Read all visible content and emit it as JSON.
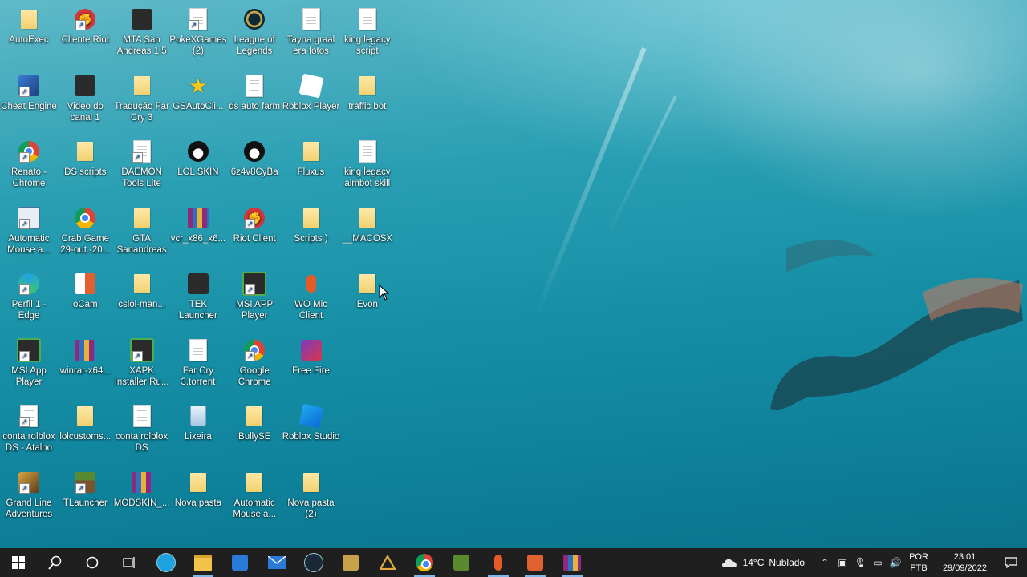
{
  "desktop": {
    "icons": [
      {
        "label": "AutoExec",
        "type": "folder"
      },
      {
        "label": "Cliente Riot",
        "type": "riot"
      },
      {
        "label": "MTA San Andreas 1.5",
        "type": "dark"
      },
      {
        "label": "PokeXGames (2)",
        "type": "file"
      },
      {
        "label": "League of Legends",
        "type": "lol"
      },
      {
        "label": "Tayna graal era fotos",
        "type": "file"
      },
      {
        "label": "king legacy script",
        "type": "file"
      },
      {
        "label": "Cheat Engine",
        "type": "cheat"
      },
      {
        "label": "Video do canal 1",
        "type": "dark"
      },
      {
        "label": "Tradução Far Cry 3",
        "type": "folder"
      },
      {
        "label": "GSAutoCli...",
        "type": "star"
      },
      {
        "label": "ds auto farm",
        "type": "file"
      },
      {
        "label": "Roblox Player",
        "type": "roblox"
      },
      {
        "label": "traffic bot",
        "type": "folder"
      },
      {
        "label": "Renato - Chrome",
        "type": "chrome"
      },
      {
        "label": "DS scripts",
        "type": "folder"
      },
      {
        "label": "DAEMON Tools Lite",
        "type": "file"
      },
      {
        "label": "LOL SKIN",
        "type": "penguin"
      },
      {
        "label": "6z4v8CyBa",
        "type": "penguin"
      },
      {
        "label": "Fluxus",
        "type": "folder"
      },
      {
        "label": "king legacy aimbot skill",
        "type": "file"
      },
      {
        "label": "Automatic Mouse a...",
        "type": "mouse"
      },
      {
        "label": "Crab Game 29-out.-20...",
        "type": "chrome"
      },
      {
        "label": "GTA Sanandreas",
        "type": "folder"
      },
      {
        "label": "vcr_x86_x6...",
        "type": "winrar"
      },
      {
        "label": "Riot Client",
        "type": "riot"
      },
      {
        "label": "Scripts )",
        "type": "folder"
      },
      {
        "label": "__MACOSX",
        "type": "folder"
      },
      {
        "label": "Perfil 1 - Edge",
        "type": "edge"
      },
      {
        "label": "oCam",
        "type": "ocam"
      },
      {
        "label": "cslol-man...",
        "type": "folder"
      },
      {
        "label": "TEK Launcher",
        "type": "dark"
      },
      {
        "label": "MSI APP Player",
        "type": "msi"
      },
      {
        "label": "WO Mic Client",
        "type": "mic"
      },
      {
        "label": "Evon",
        "type": "folder"
      },
      {
        "label": "MSI App Player",
        "type": "msi"
      },
      {
        "label": "winrar-x64...",
        "type": "winrar"
      },
      {
        "label": "XAPK Installer Ru...",
        "type": "msi"
      },
      {
        "label": "Far Cry 3.torrent",
        "type": "file"
      },
      {
        "label": "Google Chrome",
        "type": "chrome"
      },
      {
        "label": "Free Fire",
        "type": "freefire"
      },
      {
        "label": "",
        "type": "none"
      },
      {
        "label": "conta rolblox DS - Atalho",
        "type": "file"
      },
      {
        "label": "lolcustoms...",
        "type": "folder"
      },
      {
        "label": "conta rolblox DS",
        "type": "file"
      },
      {
        "label": "Lixeira",
        "type": "trash"
      },
      {
        "label": "BullySE",
        "type": "folder"
      },
      {
        "label": "Roblox Studio",
        "type": "studio"
      },
      {
        "label": "",
        "type": "none"
      },
      {
        "label": "Grand Line Adventures",
        "type": "grand"
      },
      {
        "label": "TLauncher",
        "type": "tlauncher"
      },
      {
        "label": "MODSKIN_...",
        "type": "winrar"
      },
      {
        "label": "Nova pasta",
        "type": "folder"
      },
      {
        "label": "Automatic Mouse a...",
        "type": "folder"
      },
      {
        "label": "Nova pasta (2)",
        "type": "folder"
      },
      {
        "label": "",
        "type": "none"
      }
    ]
  },
  "taskbar": {
    "apps": [
      {
        "name": "start-button",
        "color": "#ffffff",
        "glyph": "win"
      },
      {
        "name": "search-button",
        "color": "#ffffff",
        "glyph": "search"
      },
      {
        "name": "cortana-button",
        "color": "#ffffff",
        "glyph": "circle"
      },
      {
        "name": "task-view-button",
        "color": "#ffffff",
        "glyph": "taskview"
      },
      {
        "name": "edge-taskbar",
        "color": "#1fa3e0",
        "glyph": "round"
      },
      {
        "name": "file-explorer-taskbar",
        "color": "#f3c24a",
        "glyph": "folder",
        "active": true
      },
      {
        "name": "store-taskbar",
        "color": "#2a7ad8",
        "glyph": "square"
      },
      {
        "name": "mail-taskbar",
        "color": "#2a7ad8",
        "glyph": "mail"
      },
      {
        "name": "steam-taskbar",
        "color": "#1b2838",
        "glyph": "round"
      },
      {
        "name": "league-taskbar",
        "color": "#c8a24a",
        "glyph": "square"
      },
      {
        "name": "arc-taskbar",
        "color": "#e2a93b",
        "glyph": "triangle"
      },
      {
        "name": "chrome-taskbar",
        "color": "#db4437",
        "glyph": "chrome",
        "active": true
      },
      {
        "name": "minecraft-taskbar",
        "color": "#5a8a2f",
        "glyph": "square"
      },
      {
        "name": "mic-taskbar",
        "color": "#e65a2a",
        "glyph": "mic",
        "active": true
      },
      {
        "name": "ocam-taskbar",
        "color": "#e06030",
        "glyph": "square",
        "active": true
      },
      {
        "name": "winrar-taskbar",
        "color": "#8e2a7a",
        "glyph": "winrar",
        "active": true
      }
    ],
    "weather": {
      "temp": "14°C",
      "desc": "Nublado"
    },
    "language": {
      "line1": "POR",
      "line2": "PTB"
    },
    "clock": {
      "time": "23:01",
      "date": "29/09/2022"
    }
  }
}
